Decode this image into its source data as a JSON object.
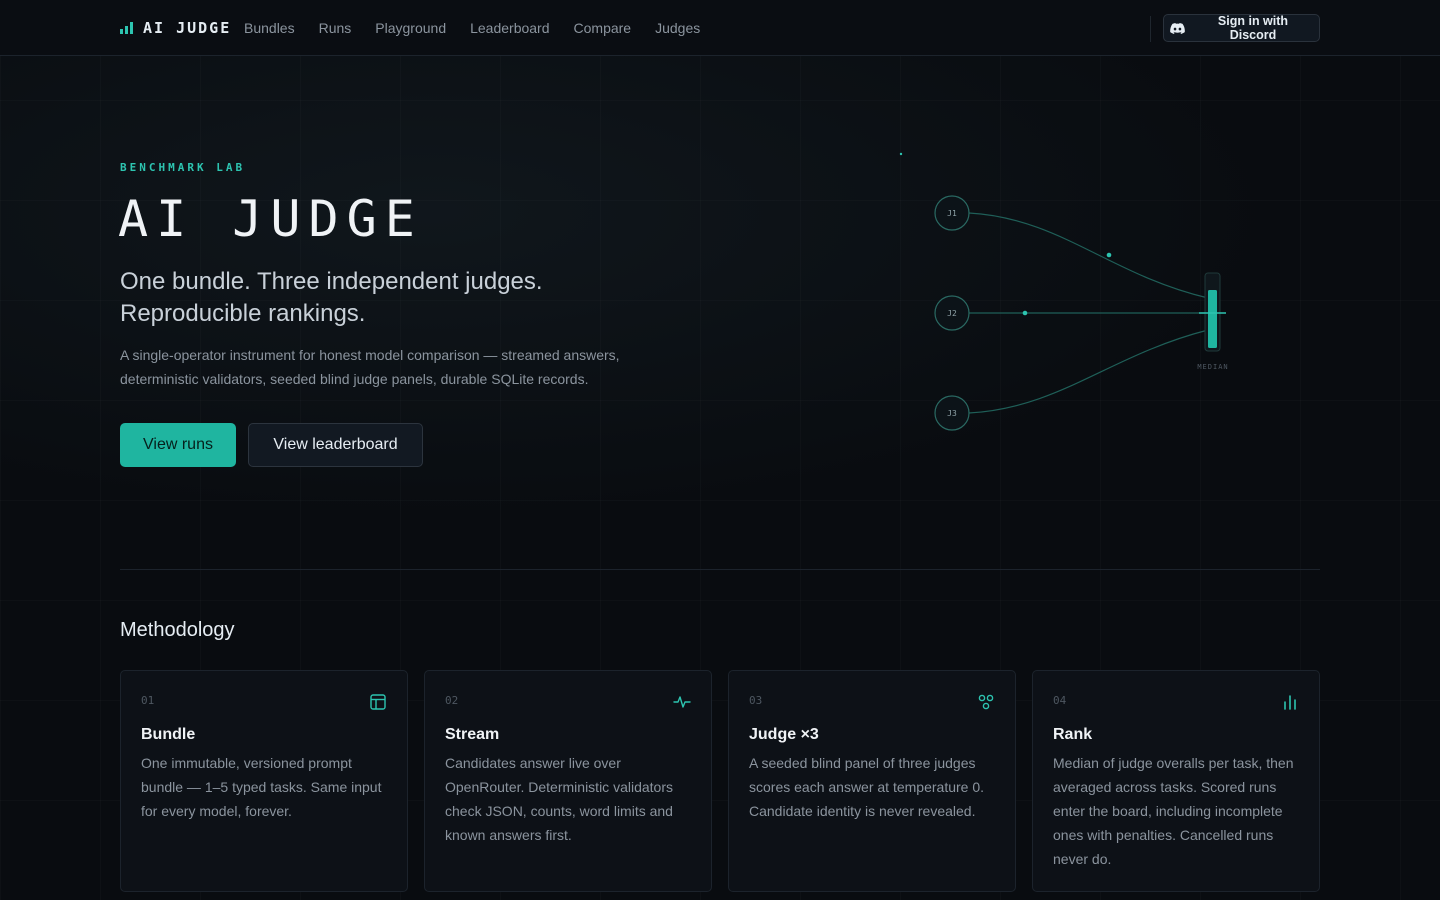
{
  "nav": {
    "brand": "AI JUDGE",
    "links": [
      "Bundles",
      "Runs",
      "Playground",
      "Leaderboard",
      "Compare",
      "Judges"
    ],
    "signin_label": "Sign in with Discord"
  },
  "hero": {
    "eyebrow": "BENCHMARK LAB",
    "title": "AI JUDGE",
    "subtitle_line1": "One bundle. Three independent judges.",
    "subtitle_line2": "Reproducible rankings.",
    "description": "A single-operator instrument for honest model comparison — streamed answers, deterministic validators, seeded blind judge panels, durable SQLite records.",
    "primary_cta": "View runs",
    "secondary_cta": "View leaderboard"
  },
  "diagram": {
    "judges": [
      "J1",
      "J2",
      "J3"
    ],
    "aggregate_label": "MEDIAN",
    "accent_color": "#2dc4b0"
  },
  "methodology": {
    "title": "Methodology",
    "cards": [
      {
        "num": "01",
        "title": "Bundle",
        "icon": "layout-icon",
        "text": "One immutable, versioned prompt bundle — 1–5 typed tasks. Same input for every model, forever."
      },
      {
        "num": "02",
        "title": "Stream",
        "icon": "activity-icon",
        "text": "Candidates answer live over OpenRouter. Deterministic validators check JSON, counts, word limits and known answers first."
      },
      {
        "num": "03",
        "title": "Judge ×3",
        "icon": "panel-icon",
        "text": "A seeded blind panel of three judges scores each answer at temperature 0. Candidate identity is never revealed."
      },
      {
        "num": "04",
        "title": "Rank",
        "icon": "bar-chart-icon",
        "text": "Median of judge overalls per task, then averaged across tasks. Scored runs enter the board, including incomplete ones with penalties. Cancelled runs never do."
      }
    ]
  }
}
